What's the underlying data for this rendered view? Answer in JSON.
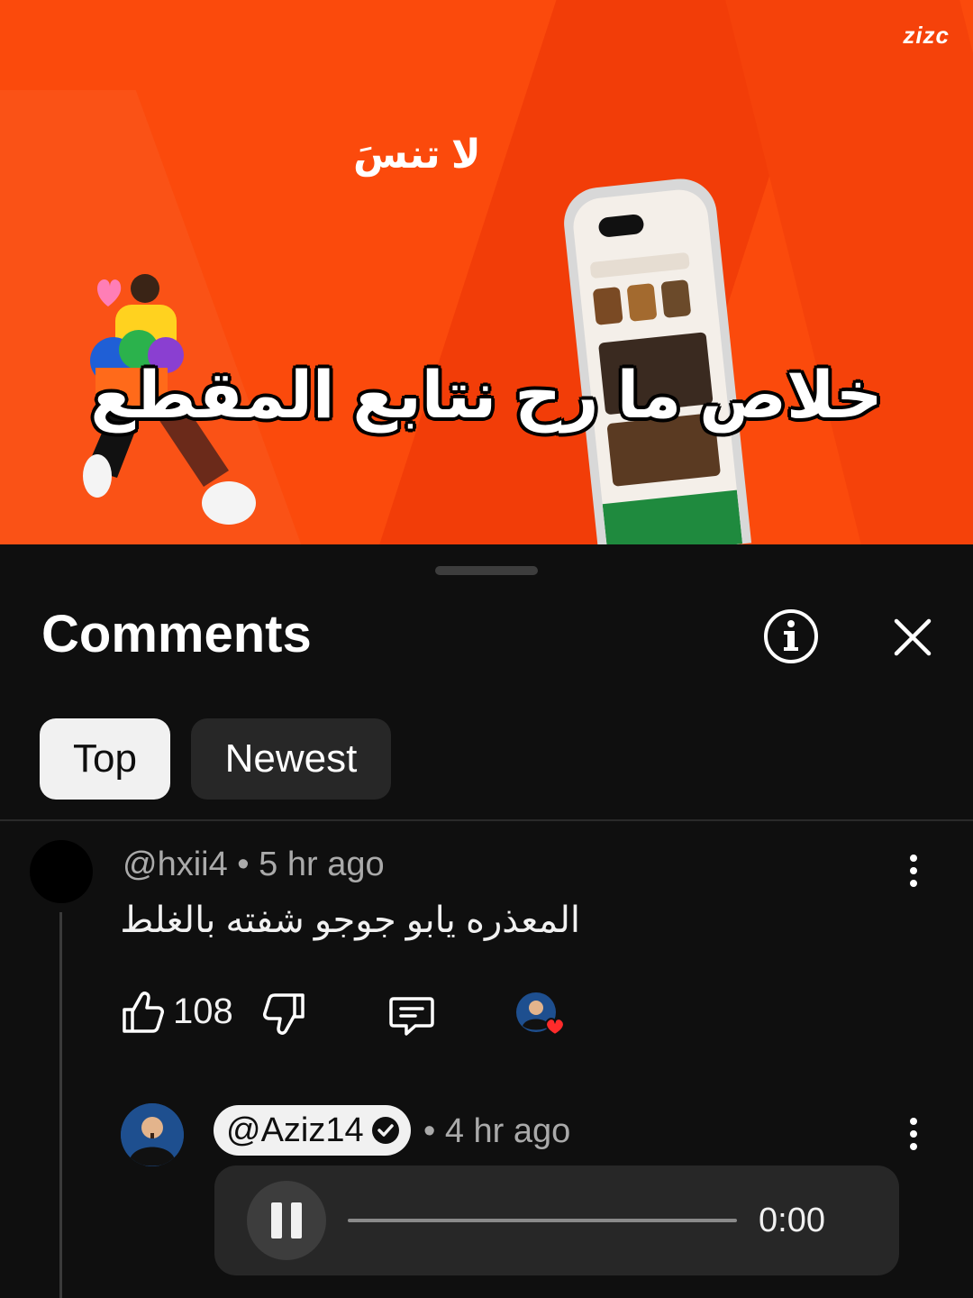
{
  "video": {
    "logo_text": "zizc",
    "small_arabic": "لا تنسَ",
    "caption": "خلاص ما رح نتابع المقطع",
    "colors": {
      "background": "#fb4a0c"
    }
  },
  "comments_panel": {
    "title": "Comments",
    "info_icon": "info-icon",
    "close_icon": "close-icon",
    "filters": [
      {
        "label": "Top",
        "selected": true
      },
      {
        "label": "Newest",
        "selected": false
      }
    ],
    "comment": {
      "author": "@hxii4",
      "time": "• 5 hr ago",
      "text": "المعذره يابو جوجو شفته بالغلط",
      "likes": "108"
    },
    "reply": {
      "author": "@Aziz14",
      "verified": true,
      "time": "• 4 hr ago",
      "audio_time": "0:00"
    }
  }
}
